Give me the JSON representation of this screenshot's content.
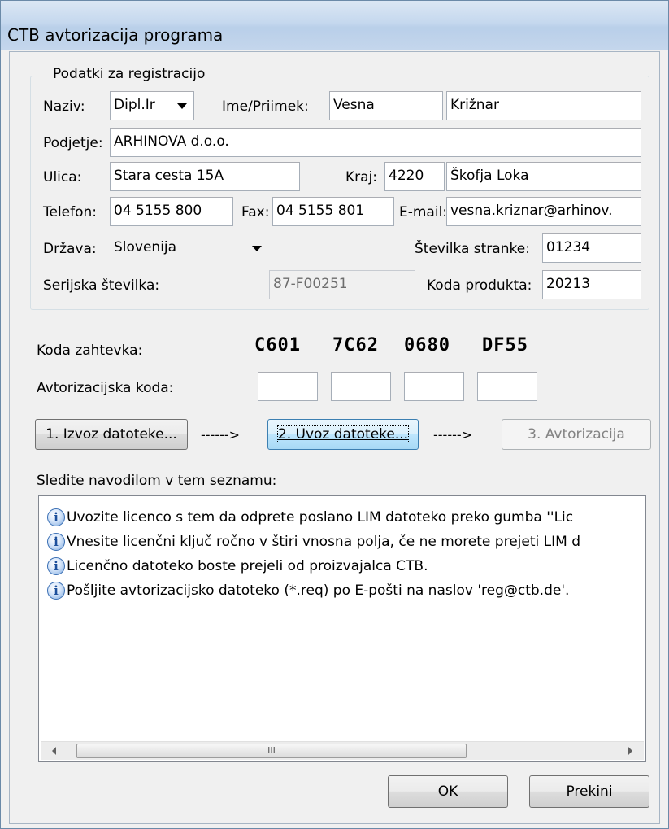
{
  "window": {
    "title": "CTB avtorizacija programa"
  },
  "group": {
    "label": "Podatki za registracijo",
    "naziv_label": "Naziv:",
    "naziv_value": "Dipl.Ir",
    "ime_label": "Ime/Priimek:",
    "ime_value": "Vesna",
    "priimek_value": "Križnar",
    "podjetje_label": "Podjetje:",
    "podjetje_value": "ARHINOVA d.o.o.",
    "ulica_label": "Ulica:",
    "ulica_value": "Stara cesta 15A",
    "kraj_label": "Kraj:",
    "kraj_postcode": "4220",
    "kraj_city": "Škofja Loka",
    "telefon_label": "Telefon:",
    "telefon_value": "04 5155 800",
    "fax_label": "Fax:",
    "fax_value": "04 5155 801",
    "email_label": "E-mail:",
    "email_value": "vesna.kriznar@arhinov.",
    "drzava_label": "Država:",
    "drzava_value": "Slovenija",
    "stevilka_stranke_label": "Številka stranke:",
    "stevilka_stranke_value": "01234",
    "serijska_label": "Serijska številka:",
    "serijska_value": "87-F00251",
    "koda_produkta_label": "Koda produkta:",
    "koda_produkta_value": "20213"
  },
  "request_code": {
    "label": "Koda zahtevka:",
    "parts": [
      "C601",
      "7C62",
      "0680",
      "DF55"
    ]
  },
  "auth_code": {
    "label": "Avtorizacijska koda:",
    "parts": [
      "",
      "",
      "",
      ""
    ]
  },
  "steps": {
    "export_button": "1. Izvoz datoteke...",
    "arrow1": "------>",
    "import_button": "2. Uvoz datoteke...",
    "arrow2": "------>",
    "authorize_button": "3. Avtorizacija"
  },
  "instructions": {
    "label": "Sledite navodilom v tem seznamu:",
    "items": [
      "Uvozite licenco s tem da odprete poslano LIM datoteko preko gumba ''Lic",
      "Vnesite licenčni ključ ročno v štiri vnosna polja, če ne morete prejeti LIM d",
      "Licenčno datoteko boste prejeli od proizvajalca CTB.",
      "Pošljite avtorizacijsko datoteko (*.req) po E-pošti na naslov 'reg@ctb.de'."
    ],
    "icon": "info-icon",
    "scroll_thumb_grip": "III"
  },
  "footer": {
    "ok_label": "OK",
    "cancel_label": "Prekini"
  }
}
